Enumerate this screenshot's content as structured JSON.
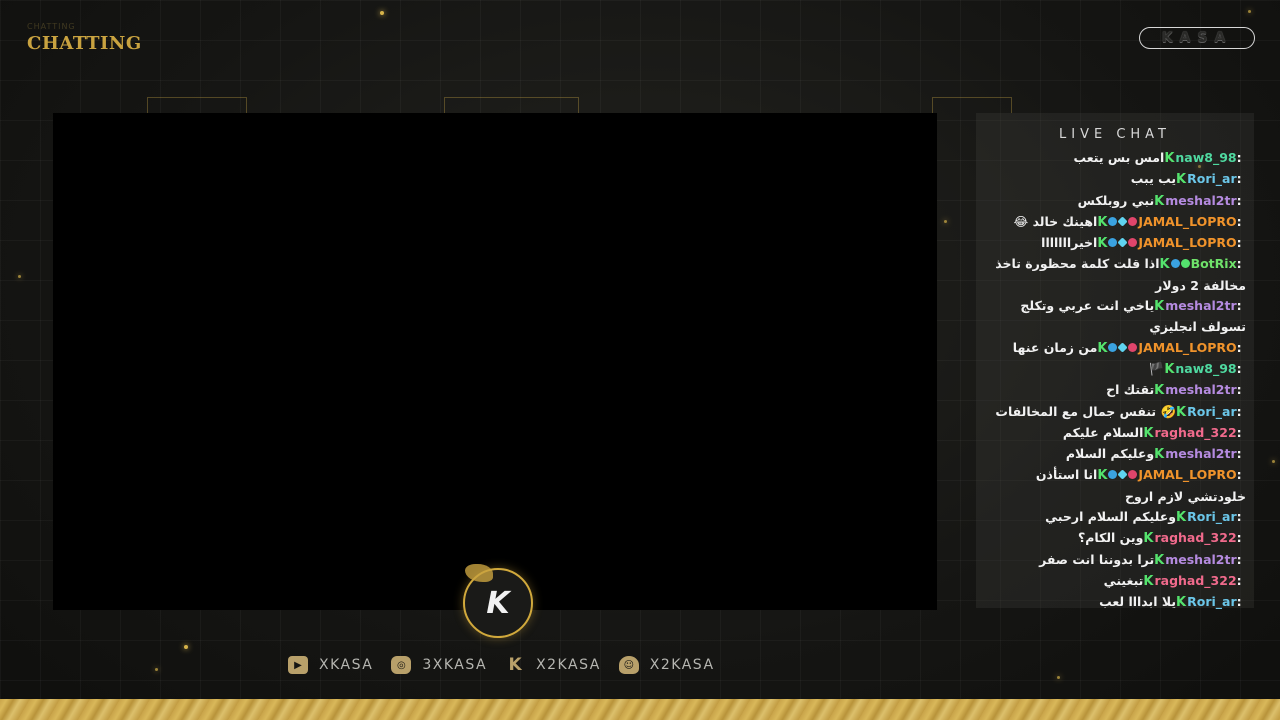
{
  "scene": {
    "title": "CHATTING",
    "brand": "KASA"
  },
  "chat": {
    "header": "LIVE CHAT",
    "accent_color": "#54e36d",
    "messages": [
      {
        "user": "naw8_98",
        "color": "#4fd9a0",
        "badges": [],
        "text": "امس بس يتعب"
      },
      {
        "user": "Rori_ar",
        "color": "#6bc6e8",
        "badges": [],
        "text": "يب يبب"
      },
      {
        "user": "meshal2tr",
        "color": "#b58be0",
        "badges": [],
        "text": "نبي روبلكس"
      },
      {
        "user": "JAMAL_LOPRO",
        "color": "#f0932b",
        "badges": [
          "mod",
          "gem",
          "sub"
        ],
        "text": "اهينك خالد 😂"
      },
      {
        "user": "JAMAL_LOPRO",
        "color": "#f0932b",
        "badges": [
          "mod",
          "gem",
          "sub"
        ],
        "text": "اخيرااااااا"
      },
      {
        "user": "BotRix",
        "color": "#6fe26a",
        "badges": [
          "mod",
          "ver"
        ],
        "text": "اذا قلت كلمة محظورة تاخذ مخالفة 2 دولار"
      },
      {
        "user": "meshal2tr",
        "color": "#b58be0",
        "badges": [],
        "text": "ياخي انت عربي وتكلج تسولف انجليزي"
      },
      {
        "user": "JAMAL_LOPRO",
        "color": "#f0932b",
        "badges": [
          "mod",
          "gem",
          "sub"
        ],
        "text": "من زمان عنها"
      },
      {
        "user": "naw8_98",
        "color": "#4fd9a0",
        "badges": [],
        "text": "🏴"
      },
      {
        "user": "meshal2tr",
        "color": "#b58be0",
        "badges": [],
        "text": "تقتك اح"
      },
      {
        "user": "Rori_ar",
        "color": "#6bc6e8",
        "badges": [],
        "text": "🤣 تنفس جمال مع المخالفات"
      },
      {
        "user": "raghad_322",
        "color": "#f06a8c",
        "badges": [],
        "text": "السلام عليكم"
      },
      {
        "user": "meshal2tr",
        "color": "#b58be0",
        "badges": [],
        "text": "وعليكم السلام"
      },
      {
        "user": "JAMAL_LOPRO",
        "color": "#f0932b",
        "badges": [
          "mod",
          "gem",
          "sub"
        ],
        "text": "انا استأذن خلودتشي لازم اروح"
      },
      {
        "user": "Rori_ar",
        "color": "#6bc6e8",
        "badges": [],
        "text": "وعليكم السلام ارحبي"
      },
      {
        "user": "raghad_322",
        "color": "#f06a8c",
        "badges": [],
        "text": "وين الكام؟"
      },
      {
        "user": "meshal2tr",
        "color": "#b58be0",
        "badges": [],
        "text": "ترا بدوننا انت صفر"
      },
      {
        "user": "raghad_322",
        "color": "#f06a8c",
        "badges": [],
        "text": "تبغيني"
      },
      {
        "user": "Rori_ar",
        "color": "#6bc6e8",
        "badges": [],
        "text": "يلا ابدااا لعب"
      }
    ]
  },
  "logo": {
    "letter": "K"
  },
  "socials": [
    {
      "icon": "youtube-icon",
      "label": "XKASA"
    },
    {
      "icon": "instagram-icon",
      "label": "3XKASA"
    },
    {
      "icon": "kick-icon",
      "label": "X2KASA"
    },
    {
      "icon": "snapchat-icon",
      "label": "X2KASA"
    }
  ]
}
